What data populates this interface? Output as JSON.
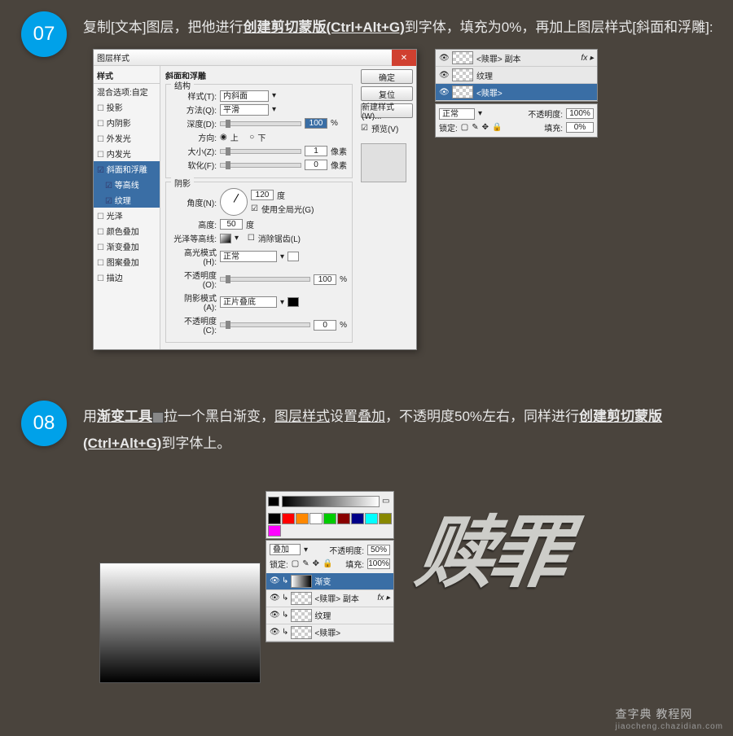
{
  "steps": {
    "s07": {
      "num": "07",
      "text_a": "复制[文本]图层，把他进行",
      "text_b": "创建剪切蒙版(Ctrl+Alt+G)",
      "text_c": "到字体，填充为0%，再加上图层样式[斜面和浮雕]:"
    },
    "s08": {
      "num": "08",
      "text_a": "用",
      "text_b": "渐变工具",
      "text_c": "拉一个黑白渐变，",
      "text_d": "图层样式",
      "text_e": "设置",
      "text_e2": "叠加",
      "text_f": "，不透明度50%左右，同样进行",
      "text_g": "创建剪切蒙版(Ctrl+Alt+G)",
      "text_h": "到字体上。"
    }
  },
  "dialog": {
    "title": "图层样式",
    "left_header": "样式",
    "left_blend": "混合选项:自定",
    "left_items": [
      {
        "label": "投影",
        "cb": "cb"
      },
      {
        "label": "内阴影",
        "cb": "cb"
      },
      {
        "label": "外发光",
        "cb": "cb"
      },
      {
        "label": "内发光",
        "cb": "cb"
      },
      {
        "label": "斜面和浮雕",
        "cb": "cbk",
        "sel": true
      },
      {
        "label": "等高线",
        "cb": "cbk",
        "sub": true,
        "sel2": true
      },
      {
        "label": "纹理",
        "cb": "cbk",
        "sub": true,
        "sel2": true
      },
      {
        "label": "光泽",
        "cb": "cb"
      },
      {
        "label": "颜色叠加",
        "cb": "cb"
      },
      {
        "label": "渐变叠加",
        "cb": "cb"
      },
      {
        "label": "图案叠加",
        "cb": "cb"
      },
      {
        "label": "描边",
        "cb": "cb"
      }
    ],
    "section_title": "斜面和浮雕",
    "group_struct": "结构",
    "lbl_style": "样式(T):",
    "val_style": "内斜面",
    "lbl_method": "方法(Q):",
    "val_method": "平滑",
    "lbl_depth": "深度(D):",
    "val_depth": "100",
    "unit_pct": "%",
    "lbl_dir": "方向:",
    "dir_up": "上",
    "dir_down": "下",
    "lbl_size": "大小(Z):",
    "val_size": "1",
    "unit_px": "像素",
    "lbl_soft": "软化(F):",
    "val_soft": "0",
    "group_shadow": "阴影",
    "lbl_angle": "角度(N):",
    "val_angle": "120",
    "unit_deg": "度",
    "lbl_global": "使用全局光(G)",
    "lbl_alt": "高度:",
    "val_alt": "50",
    "lbl_gloss": "光泽等高线:",
    "lbl_anti": "消除锯齿(L)",
    "lbl_hmode": "高光模式(H):",
    "val_hmode": "正常",
    "lbl_hopac": "不透明度(O):",
    "val_hopac": "100",
    "lbl_smode": "阴影模式(A):",
    "val_smode": "正片叠底",
    "lbl_sopac": "不透明度(C):",
    "val_sopac": "0",
    "btn_ok": "确定",
    "btn_reset": "复位",
    "btn_new": "新建样式(W)...",
    "lbl_preview": "预览(V)"
  },
  "minipanel7": {
    "rows": [
      {
        "name": "<赎罪> 副本",
        "fx": "fx ▸"
      },
      {
        "name": "纹理",
        "fx": ""
      },
      {
        "name": "<赎罪>",
        "sel": true
      }
    ],
    "opt_mode": "正常",
    "opt_opac_label": "不透明度:",
    "opt_opac": "100%",
    "opt_lock": "锁定:",
    "opt_fill_label": "填充:",
    "opt_fill": "0%"
  },
  "gradpanel": {
    "swatches": [
      "#000",
      "#f00",
      "#f80",
      "#fff",
      "#0c0",
      "#800",
      "#008",
      "#0ff",
      "#880",
      "#f0f"
    ]
  },
  "panel08b": {
    "opt_mode": "叠加",
    "opt_opac_label": "不透明度:",
    "opt_opac": "50%",
    "opt_lock": "锁定:",
    "opt_fill_label": "填充:",
    "opt_fill": "100%",
    "rows": [
      {
        "name": "渐变",
        "sel": true
      },
      {
        "name": "<赎罪> 副本",
        "fx": "fx ▸"
      },
      {
        "name": "纹理"
      },
      {
        "name": "<赎罪>"
      }
    ]
  },
  "artwork_text": "赎罪",
  "footer": {
    "site": "查字典 教程网",
    "url": "jiaocheng.chazidian.com"
  }
}
